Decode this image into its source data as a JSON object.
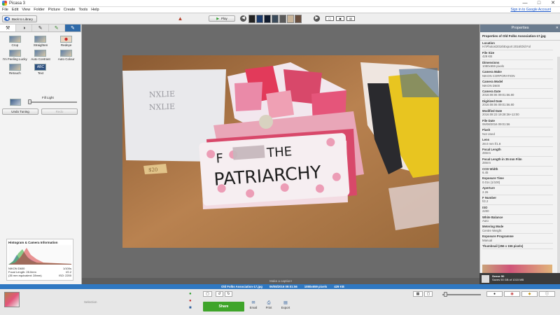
{
  "window": {
    "title": "Picasa 3"
  },
  "menu": [
    "File",
    "Edit",
    "View",
    "Folder",
    "Picture",
    "Create",
    "Tools",
    "Help"
  ],
  "signin": "Sign in to Google Account",
  "toolbar": {
    "back_label": "Back to Library",
    "play_label": "Play"
  },
  "left_tabs": [
    "wrench-icon",
    "contrast-icon",
    "brush-icon",
    "brush-color-icon",
    "brush-blue-icon"
  ],
  "tools": [
    {
      "label": "Crop"
    },
    {
      "label": "Straighten"
    },
    {
      "label": "Redeye"
    },
    {
      "label": "I'm Feeling Lucky"
    },
    {
      "label": "Auto Contrast"
    },
    {
      "label": "Auto Colour"
    },
    {
      "label": "Retouch"
    },
    {
      "label": "Text"
    }
  ],
  "text_tool_glyph": "ABC",
  "fill_light": {
    "label": "Fill Light",
    "value": 0.0
  },
  "undo_label": "Undo Tuning",
  "redo_label": "Redo",
  "histogram": {
    "title": "Histogram & Camera Information",
    "left": [
      "NIKON D600",
      "Focal Length: 28.0mm",
      "(35 mm equivalent: 28mm)"
    ],
    "right": [
      "1/100s",
      "f/2.2",
      "ISO: 2200"
    ]
  },
  "caption_placeholder": "Make a caption!",
  "properties": {
    "title": "Properties",
    "file": "Properties of Old Folks Association-17.jpg",
    "items": [
      {
        "k": "Location",
        "v": "H:\\Photos\\2016\\Export 2016\\Old Fol"
      },
      {
        "k": "File Size",
        "v": "429 KB"
      },
      {
        "k": "Dimensions",
        "v": "1080x659 pixels"
      },
      {
        "k": "Camera Make",
        "v": "NIKON CORPORATION"
      },
      {
        "k": "Camera Model",
        "v": "NIKON D600"
      },
      {
        "k": "Camera Date",
        "v": "2016:08:06 09:01:56.80"
      },
      {
        "k": "Digitized Date",
        "v": "2016:08:06 09:01:56.80"
      },
      {
        "k": "Modified Date",
        "v": "2016:08:23 19:28:36+12:00"
      },
      {
        "k": "File Date",
        "v": "06/08/2016 09:01:56"
      },
      {
        "k": "Flash",
        "v": "Not Used"
      },
      {
        "k": "Lens",
        "v": "28.0 mm f/1.8"
      },
      {
        "k": "Focal Length",
        "v": "28mm"
      },
      {
        "k": "Focal Length in 35 mm Film",
        "v": "28mm"
      },
      {
        "k": "CCD Width",
        "v": "6.45"
      },
      {
        "k": "Exposure Time",
        "v": "0.01s (1/100)"
      },
      {
        "k": "Aperture",
        "v": "2.26"
      },
      {
        "k": "F Number",
        "v": "f/2.2"
      },
      {
        "k": "ISO",
        "v": "2200"
      },
      {
        "k": "White Balance",
        "v": "Auto"
      },
      {
        "k": "Metering Mode",
        "v": "Centre Weight"
      },
      {
        "k": "Exposure Programme",
        "v": "Manual"
      },
      {
        "k": "Thumbnail (256 x 156 pixels)",
        "v": ""
      }
    ]
  },
  "notification": {
    "title": "Sense 50",
    "line": "Saves 50 GB of 1015 MB"
  },
  "status": {
    "file": "Old Folks Association-17.jpg",
    "date": "06/08/2016 09:01:56",
    "dims": "1080x659 pixels",
    "size": "429 KB"
  },
  "tray": {
    "selection": "Selection",
    "share": "Share",
    "actions": [
      "Email",
      "Print",
      "Export"
    ]
  },
  "photo_text": [
    "F",
    "THE",
    "PATRIARCHY"
  ],
  "price_tag": "$20"
}
